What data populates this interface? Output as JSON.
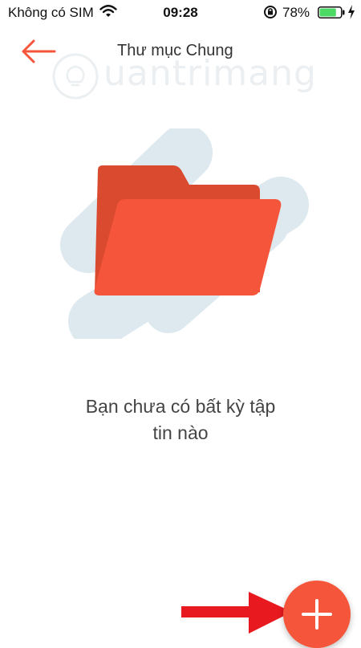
{
  "status_bar": {
    "carrier": "Không có SIM",
    "time": "09:28",
    "battery_percent": "78%",
    "battery_level": 0.78
  },
  "header": {
    "title": "Thư mục Chung"
  },
  "watermark": {
    "text": "uantrimang"
  },
  "empty_state": {
    "message_line1": "Bạn chưa có bất kỳ tập",
    "message_line2": "tin nào"
  },
  "colors": {
    "accent": "#f5553a",
    "folder_back": "#d94a2f",
    "blob": "#dde9ef",
    "battery": "#4cd964"
  },
  "icons": {
    "back": "arrow-left-icon",
    "fab": "plus-icon",
    "folder": "folder-icon"
  }
}
